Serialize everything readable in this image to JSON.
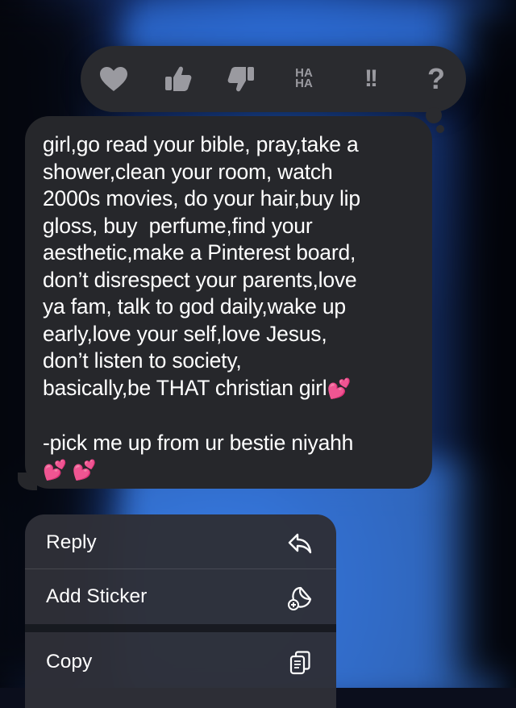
{
  "tapbacks": [
    {
      "name": "heart",
      "icon": "heart-icon"
    },
    {
      "name": "thumbs-up",
      "icon": "thumbs-up-icon"
    },
    {
      "name": "thumbs-down",
      "icon": "thumbs-down-icon"
    },
    {
      "name": "haha",
      "text_top": "HA",
      "text_bottom": "HA"
    },
    {
      "name": "emphasis",
      "text": "!!"
    },
    {
      "name": "question",
      "text": "?"
    }
  ],
  "message": {
    "lines": [
      "girl,go read your bible, pray,take a",
      "shower,clean your room, watch",
      "2000s movies, do your hair,buy lip",
      "gloss, buy  perfume,find your",
      "aesthetic,make a Pinterest board,",
      "don’t disrespect your parents,love",
      "ya fam, talk to god daily,wake up",
      "early,love your self,love Jesus,",
      "don’t listen to society,",
      "basically,be THAT christian girl"
    ],
    "signature_line": "-pick me up from ur bestie niyahh",
    "emoji": "💕",
    "bubble_color": "#26272b"
  },
  "menu": {
    "items": [
      {
        "label": "Reply",
        "icon": "reply-icon"
      },
      {
        "label": "Add Sticker",
        "icon": "sticker-icon"
      },
      {
        "label": "Copy",
        "icon": "copy-icon"
      }
    ]
  },
  "colors": {
    "accent_heart": "#ff4fb8",
    "tapback_icon": "#9a9aa0"
  }
}
